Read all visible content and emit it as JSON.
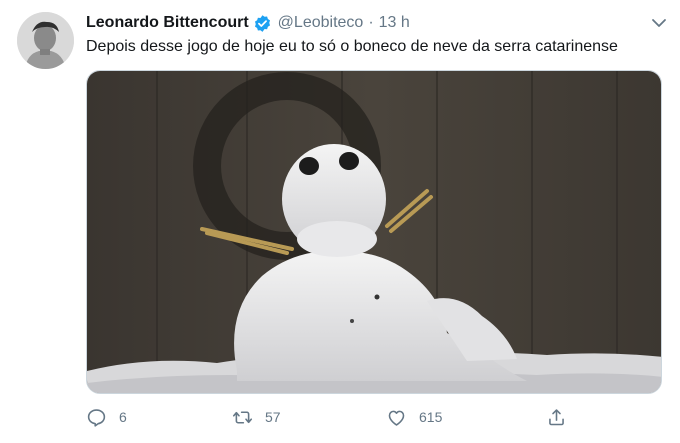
{
  "tweet": {
    "author_name": "Leonardo Bittencourt",
    "handle": "@Leobiteco",
    "separator": "·",
    "time": "13 h",
    "text": "Depois desse jogo de hoje eu to só o boneco de neve da serra catarinense",
    "avatar_icon": "profile-photo",
    "verified_icon": "verified-badge-icon",
    "media_alt": "snowman photo"
  },
  "actions": {
    "reply_count": "6",
    "retweet_count": "57",
    "like_count": "615"
  },
  "colors": {
    "text": "#14171a",
    "secondary": "#657786",
    "verified": "#1da1f2",
    "border": "#ccd6dd"
  }
}
